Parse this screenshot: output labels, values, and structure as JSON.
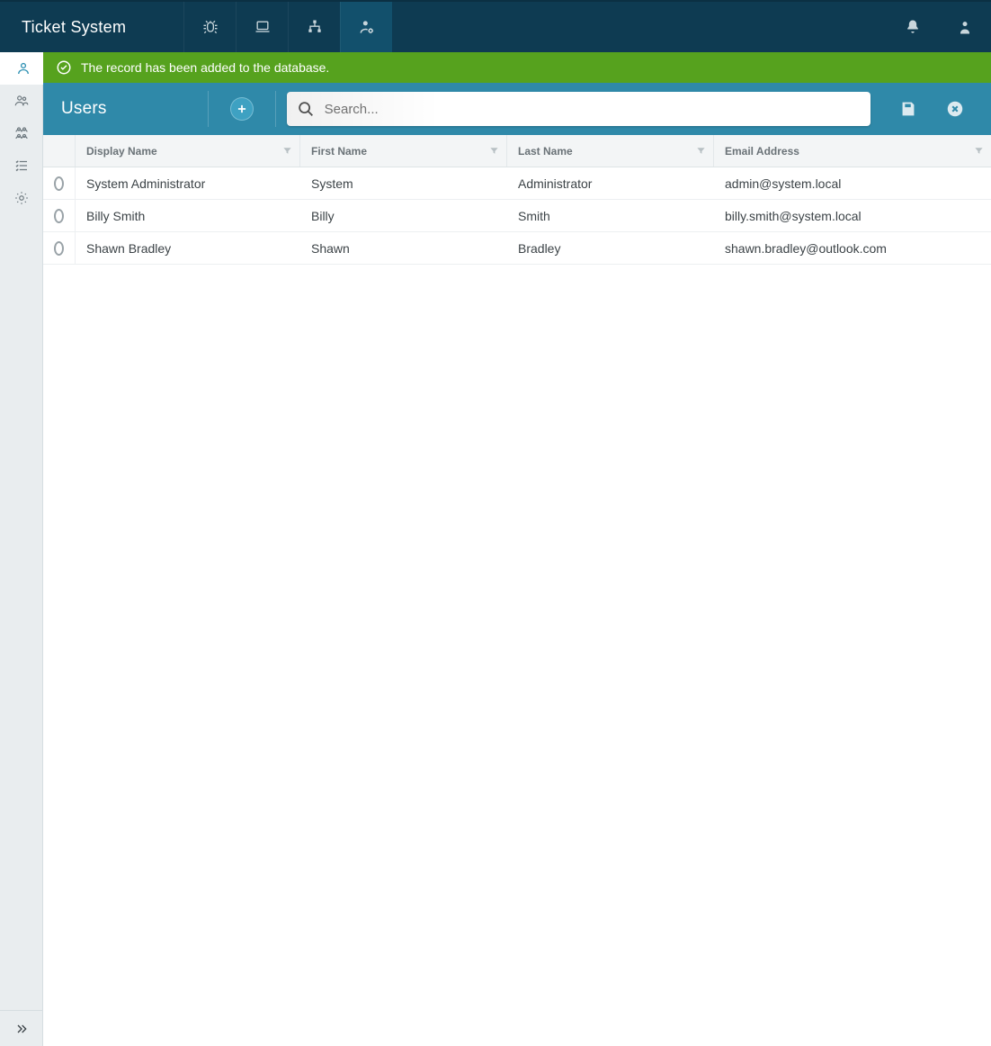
{
  "app": {
    "title": "Ticket System"
  },
  "topnav": {
    "items": [
      {
        "name": "bug-icon",
        "active": false
      },
      {
        "name": "laptop-icon",
        "active": false
      },
      {
        "name": "sitemap-icon",
        "active": false
      },
      {
        "name": "user-cog-icon",
        "active": true
      }
    ],
    "right": [
      {
        "name": "bell-icon"
      },
      {
        "name": "user-badge-icon"
      }
    ]
  },
  "sidebar": {
    "items": [
      {
        "name": "user-icon",
        "active": true
      },
      {
        "name": "users-icon",
        "active": false
      },
      {
        "name": "folder-tree-icon",
        "active": false
      },
      {
        "name": "list-check-icon",
        "active": false
      },
      {
        "name": "gear-icon",
        "active": false
      }
    ]
  },
  "banner": {
    "message": "The record has been added to the database."
  },
  "toolbar": {
    "title": "Users",
    "search_placeholder": "Search..."
  },
  "table": {
    "columns": [
      {
        "key": "display_name",
        "label": "Display Name"
      },
      {
        "key": "first_name",
        "label": "First Name"
      },
      {
        "key": "last_name",
        "label": "Last Name"
      },
      {
        "key": "email",
        "label": "Email Address"
      }
    ],
    "rows": [
      {
        "display_name": "System Administrator",
        "first_name": "System",
        "last_name": "Administrator",
        "email": "admin@system.local"
      },
      {
        "display_name": "Billy Smith",
        "first_name": "Billy",
        "last_name": "Smith",
        "email": "billy.smith@system.local"
      },
      {
        "display_name": "Shawn Bradley",
        "first_name": "Shawn",
        "last_name": "Bradley",
        "email": "shawn.bradley@outlook.com"
      }
    ]
  }
}
